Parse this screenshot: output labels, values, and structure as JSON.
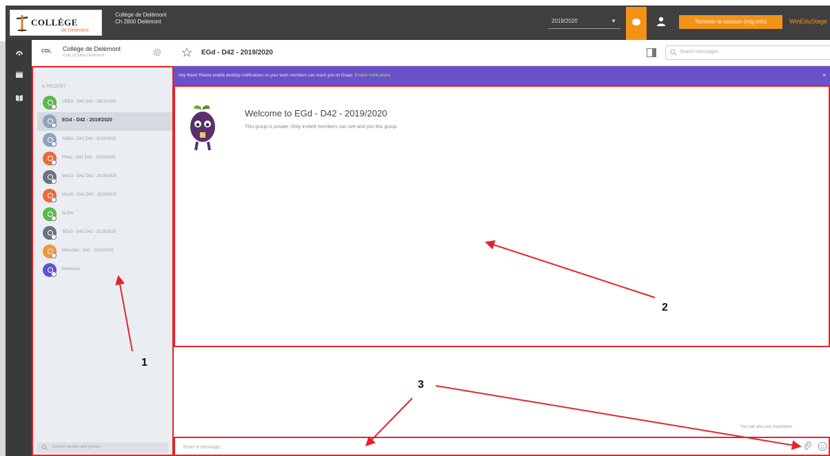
{
  "topbar": {
    "logo_text": "COLLÈGE",
    "logo_sub": "de Delémont",
    "school_line1": "Collège de Delémont",
    "school_line2": "Ch 2800 Delémont",
    "year": "2019/2020",
    "orange_button": "Terminer la session (mig-info)",
    "extra_link": "WinEduStage"
  },
  "header": {
    "team_logo": "CDL",
    "team_name": "Collège de Delémont",
    "team_sub": "Cols d'Outre Delémont",
    "room_title": "EGd - D42 - 2019/2020",
    "search_placeholder": "Search messages"
  },
  "sidebar": {
    "recent_label": "RECENT",
    "rooms": [
      {
        "label": "GEEd - D41 D42 - 2019/2020",
        "color": "#5cb84f"
      },
      {
        "label": "EGd - D42 - 2019/2020",
        "color": "#8fa3bf",
        "active": true
      },
      {
        "label": "ANEd - D41 D42 - 2019/2020",
        "color": "#8fa3bf"
      },
      {
        "label": "FReb - D41 D42 - 2019/2020",
        "color": "#e86a3d"
      },
      {
        "label": "MAcD - D41 D42 - 2019/2020",
        "color": "#6b7280"
      },
      {
        "label": "MAsR - D41 D42 - 2019/2020",
        "color": "#e86a3d"
      },
      {
        "label": "ALEm",
        "color": "#5cb84f"
      },
      {
        "label": "SEsD - D41 D42 - 2019/2020",
        "color": "#6b7280"
      },
      {
        "label": "Maturités - D42 - 2019/2020",
        "color": "#f0953a"
      },
      {
        "label": "Annonces",
        "color": "#5a56c9"
      }
    ],
    "people_search": "Search people and groups"
  },
  "notification": {
    "text": "Hey there! Please enable desktop notifications so your team members can reach you on Graax.",
    "link": "Enable notifications",
    "close": "×"
  },
  "main": {
    "welcome_title": "Welcome to EGd - D42 - 2019/2020",
    "welcome_sub": "This group is private. Only invited members can see and join this group.",
    "markdown_note": "You can also use markdown",
    "compose_placeholder": "Enter a message..."
  },
  "annotations": [
    "1",
    "2",
    "3"
  ],
  "colors": {
    "accent_orange": "#f39316",
    "notification_purple": "#6a51c7",
    "annotation_red": "#e3242b"
  }
}
